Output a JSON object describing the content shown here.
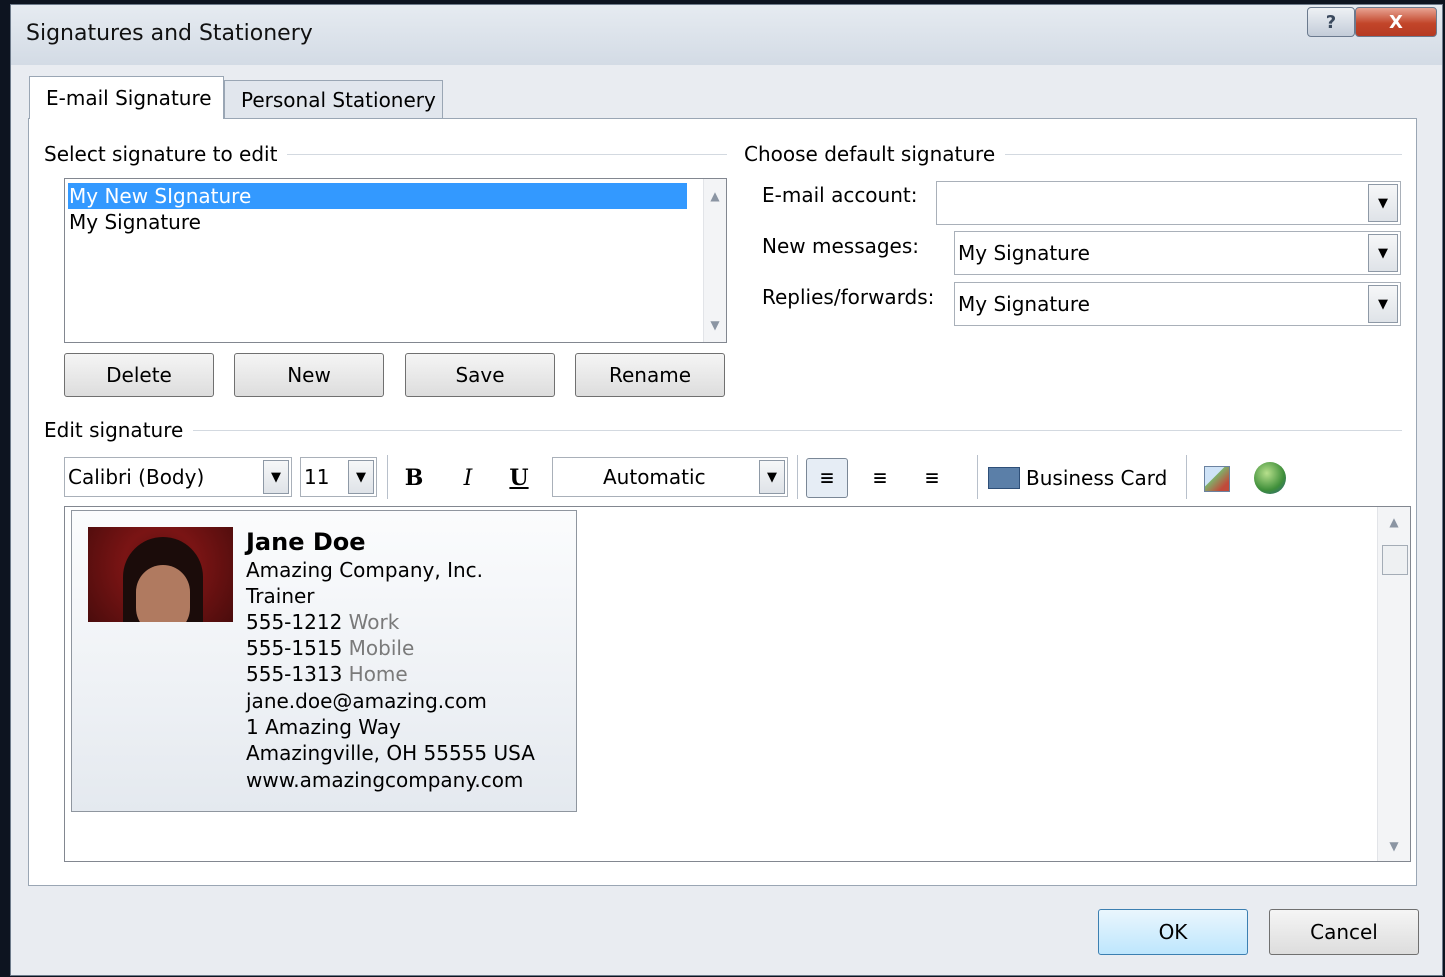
{
  "window": {
    "title": "Signatures and Stationery",
    "help_symbol": "?",
    "close_symbol": "X"
  },
  "tabs": [
    {
      "label": "E-mail Signature",
      "active": true
    },
    {
      "label": "Personal Stationery",
      "active": false
    }
  ],
  "select_section": {
    "label": "Select signature to edit",
    "items": [
      "My New SIgnature",
      "My Signature"
    ],
    "selected_index": 0
  },
  "signature_buttons": {
    "delete": "Delete",
    "new": "New",
    "save": "Save",
    "rename": "Rename"
  },
  "default_section": {
    "label": "Choose default signature",
    "email_account_label": "E-mail account:",
    "email_account_value": "",
    "new_messages_label": "New messages:",
    "new_messages_value": "My Signature",
    "replies_label": "Replies/forwards:",
    "replies_value": "My Signature"
  },
  "edit_section": {
    "label": "Edit signature",
    "font": "Calibri (Body)",
    "size": "11",
    "bold": "B",
    "italic": "I",
    "underline": "U",
    "color": "Automatic",
    "business_card": "Business Card"
  },
  "signature": {
    "name": "Jane Doe",
    "company": "Amazing Company, Inc.",
    "title": "Trainer",
    "phones": [
      {
        "number": "555-1212",
        "label": "Work"
      },
      {
        "number": "555-1515",
        "label": "Mobile"
      },
      {
        "number": "555-1313",
        "label": "Home"
      }
    ],
    "email": "jane.doe@amazing.com",
    "address1": "1 Amazing Way",
    "address2": "Amazingville, OH 55555 USA",
    "website": "www.amazingcompany.com"
  },
  "footer": {
    "ok": "OK",
    "cancel": "Cancel"
  },
  "colors": {
    "selection": "#3399ff",
    "close_button": "#c2452a",
    "ok_button": "#cfe6f8"
  }
}
